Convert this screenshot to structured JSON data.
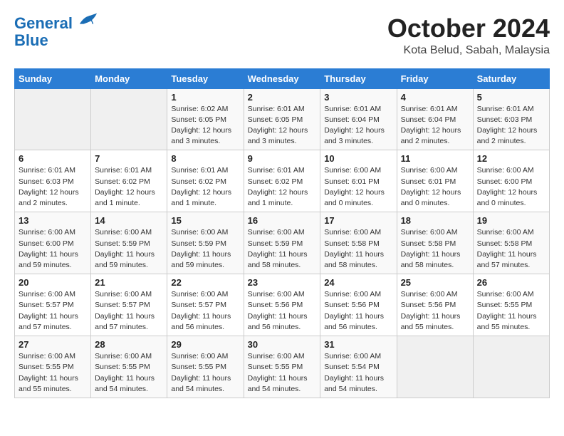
{
  "header": {
    "logo_line1": "General",
    "logo_line2": "Blue",
    "month_title": "October 2024",
    "location": "Kota Belud, Sabah, Malaysia"
  },
  "days_of_week": [
    "Sunday",
    "Monday",
    "Tuesday",
    "Wednesday",
    "Thursday",
    "Friday",
    "Saturday"
  ],
  "weeks": [
    [
      {
        "day": "",
        "info": ""
      },
      {
        "day": "",
        "info": ""
      },
      {
        "day": "1",
        "info": "Sunrise: 6:02 AM\nSunset: 6:05 PM\nDaylight: 12 hours and 3 minutes."
      },
      {
        "day": "2",
        "info": "Sunrise: 6:01 AM\nSunset: 6:05 PM\nDaylight: 12 hours and 3 minutes."
      },
      {
        "day": "3",
        "info": "Sunrise: 6:01 AM\nSunset: 6:04 PM\nDaylight: 12 hours and 3 minutes."
      },
      {
        "day": "4",
        "info": "Sunrise: 6:01 AM\nSunset: 6:04 PM\nDaylight: 12 hours and 2 minutes."
      },
      {
        "day": "5",
        "info": "Sunrise: 6:01 AM\nSunset: 6:03 PM\nDaylight: 12 hours and 2 minutes."
      }
    ],
    [
      {
        "day": "6",
        "info": "Sunrise: 6:01 AM\nSunset: 6:03 PM\nDaylight: 12 hours and 2 minutes."
      },
      {
        "day": "7",
        "info": "Sunrise: 6:01 AM\nSunset: 6:02 PM\nDaylight: 12 hours and 1 minute."
      },
      {
        "day": "8",
        "info": "Sunrise: 6:01 AM\nSunset: 6:02 PM\nDaylight: 12 hours and 1 minute."
      },
      {
        "day": "9",
        "info": "Sunrise: 6:01 AM\nSunset: 6:02 PM\nDaylight: 12 hours and 1 minute."
      },
      {
        "day": "10",
        "info": "Sunrise: 6:00 AM\nSunset: 6:01 PM\nDaylight: 12 hours and 0 minutes."
      },
      {
        "day": "11",
        "info": "Sunrise: 6:00 AM\nSunset: 6:01 PM\nDaylight: 12 hours and 0 minutes."
      },
      {
        "day": "12",
        "info": "Sunrise: 6:00 AM\nSunset: 6:00 PM\nDaylight: 12 hours and 0 minutes."
      }
    ],
    [
      {
        "day": "13",
        "info": "Sunrise: 6:00 AM\nSunset: 6:00 PM\nDaylight: 11 hours and 59 minutes."
      },
      {
        "day": "14",
        "info": "Sunrise: 6:00 AM\nSunset: 5:59 PM\nDaylight: 11 hours and 59 minutes."
      },
      {
        "day": "15",
        "info": "Sunrise: 6:00 AM\nSunset: 5:59 PM\nDaylight: 11 hours and 59 minutes."
      },
      {
        "day": "16",
        "info": "Sunrise: 6:00 AM\nSunset: 5:59 PM\nDaylight: 11 hours and 58 minutes."
      },
      {
        "day": "17",
        "info": "Sunrise: 6:00 AM\nSunset: 5:58 PM\nDaylight: 11 hours and 58 minutes."
      },
      {
        "day": "18",
        "info": "Sunrise: 6:00 AM\nSunset: 5:58 PM\nDaylight: 11 hours and 58 minutes."
      },
      {
        "day": "19",
        "info": "Sunrise: 6:00 AM\nSunset: 5:58 PM\nDaylight: 11 hours and 57 minutes."
      }
    ],
    [
      {
        "day": "20",
        "info": "Sunrise: 6:00 AM\nSunset: 5:57 PM\nDaylight: 11 hours and 57 minutes."
      },
      {
        "day": "21",
        "info": "Sunrise: 6:00 AM\nSunset: 5:57 PM\nDaylight: 11 hours and 57 minutes."
      },
      {
        "day": "22",
        "info": "Sunrise: 6:00 AM\nSunset: 5:57 PM\nDaylight: 11 hours and 56 minutes."
      },
      {
        "day": "23",
        "info": "Sunrise: 6:00 AM\nSunset: 5:56 PM\nDaylight: 11 hours and 56 minutes."
      },
      {
        "day": "24",
        "info": "Sunrise: 6:00 AM\nSunset: 5:56 PM\nDaylight: 11 hours and 56 minutes."
      },
      {
        "day": "25",
        "info": "Sunrise: 6:00 AM\nSunset: 5:56 PM\nDaylight: 11 hours and 55 minutes."
      },
      {
        "day": "26",
        "info": "Sunrise: 6:00 AM\nSunset: 5:55 PM\nDaylight: 11 hours and 55 minutes."
      }
    ],
    [
      {
        "day": "27",
        "info": "Sunrise: 6:00 AM\nSunset: 5:55 PM\nDaylight: 11 hours and 55 minutes."
      },
      {
        "day": "28",
        "info": "Sunrise: 6:00 AM\nSunset: 5:55 PM\nDaylight: 11 hours and 54 minutes."
      },
      {
        "day": "29",
        "info": "Sunrise: 6:00 AM\nSunset: 5:55 PM\nDaylight: 11 hours and 54 minutes."
      },
      {
        "day": "30",
        "info": "Sunrise: 6:00 AM\nSunset: 5:55 PM\nDaylight: 11 hours and 54 minutes."
      },
      {
        "day": "31",
        "info": "Sunrise: 6:00 AM\nSunset: 5:54 PM\nDaylight: 11 hours and 54 minutes."
      },
      {
        "day": "",
        "info": ""
      },
      {
        "day": "",
        "info": ""
      }
    ]
  ]
}
